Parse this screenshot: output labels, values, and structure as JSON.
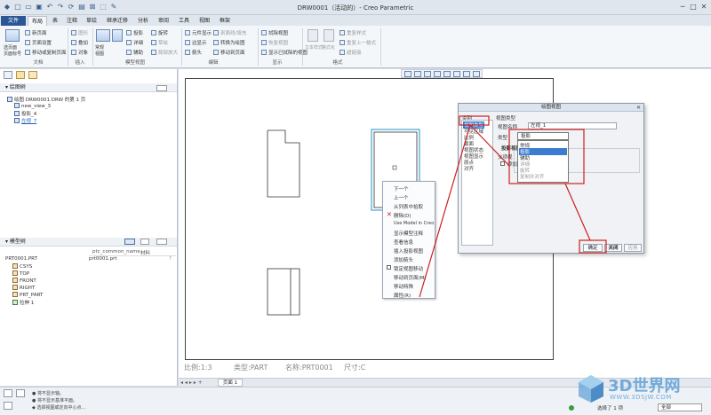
{
  "window": {
    "title": "DRW0001（活动的）- Creo Parametric"
  },
  "tabs": [
    "文件",
    "布局",
    "表",
    "注释",
    "草绘",
    "继承迁移",
    "分析",
    "审阅",
    "工具",
    "视图",
    "框架"
  ],
  "ribbon": {
    "doc_items": [
      "新页面",
      "页面设置",
      "移动或复制页面"
    ],
    "doc_big": "选页面\n页面标号",
    "insert_items": [
      "图形",
      "叠加",
      "对象"
    ],
    "model_view_big": "常规\n视图",
    "model_view_items": [
      "投影",
      "详细",
      "辅助",
      "旋转",
      "草绘",
      "局部放大",
      "绘图视图"
    ],
    "edit_items": [
      "元件显示",
      "边显示",
      "箭头",
      "转换为绘图",
      "移动到页面"
    ],
    "edit_dim_items": [
      "剖面线/填充",
      "删除到对齐",
      "将视图"
    ],
    "display_items": [
      "拭除视图",
      "恢复视图",
      "显示已拭除的视图"
    ],
    "format_items": [
      "重复样式",
      "重复上一格式",
      "超链接",
      "文本样式",
      "格式化"
    ],
    "groups": [
      "文档",
      "插入",
      "模型视图",
      "编辑",
      "显示",
      "格式"
    ]
  },
  "drawing_tree": {
    "title": "绘图树",
    "items": [
      "绘图 DRW0001.DRW 的第 1 页",
      "new_view_3",
      "投影_4",
      "左视_7"
    ]
  },
  "model_tree": {
    "title": "模型树",
    "columns": [
      "ptc_common_name",
      "材料"
    ],
    "root": "PRT0001.PRT",
    "root_value": "prt0001.prt",
    "items": [
      "CSYS",
      "TOP",
      "FRONT",
      "RIGHT",
      "PRT_PART",
      "拉伸 1"
    ]
  },
  "status": {
    "scale": "比例:1:3",
    "type": "类型:PART",
    "name": "名称:PRT0001",
    "size": "尺寸:C"
  },
  "page_tab": "页面 1",
  "messages": [
    "将不显示轴。",
    "将不显示基准平面。",
    "选择视图或定向中心点..."
  ],
  "selection_status": "选择了 1 项",
  "filter": "全部",
  "context_menu": {
    "items": [
      "下一个",
      "上一个",
      "从列表中拾取",
      "删除(D)",
      "Use Model in Creo",
      "显示模型注释",
      "查看信息",
      "插入投影视图",
      "添加箭头",
      "锁定视图移动",
      "移动到页面(M)",
      "移动特殊",
      "属性(R)"
    ]
  },
  "dialog": {
    "title": "绘图视图",
    "category_label": "类别",
    "categories": [
      "视图类型",
      "可见区域",
      "比例",
      "截面",
      "视图状态",
      "视图显示",
      "原点",
      "对齐"
    ],
    "view_type_label": "视图类型",
    "view_name_label": "视图名称",
    "view_name_value": "左视_1",
    "type_label": "类型",
    "type_value": "投影",
    "dropdown_options": [
      "投影",
      "常规",
      "投影",
      "辅助",
      "详细",
      "旋转",
      "复制并对齐"
    ],
    "projection_label": "投影视图",
    "parent_label": "父项视",
    "add_arrow_label": "添加",
    "ok_label": "确定",
    "cancel_label": "关闭",
    "apply_label": "应用"
  },
  "watermark": {
    "brand": "3D世界网",
    "url": "WWW.3DSJW.COM"
  },
  "colors": {
    "accent_blue": "#2b5797",
    "selection_cyan": "#1e90c8",
    "annotation_red": "#cc1f1f"
  }
}
